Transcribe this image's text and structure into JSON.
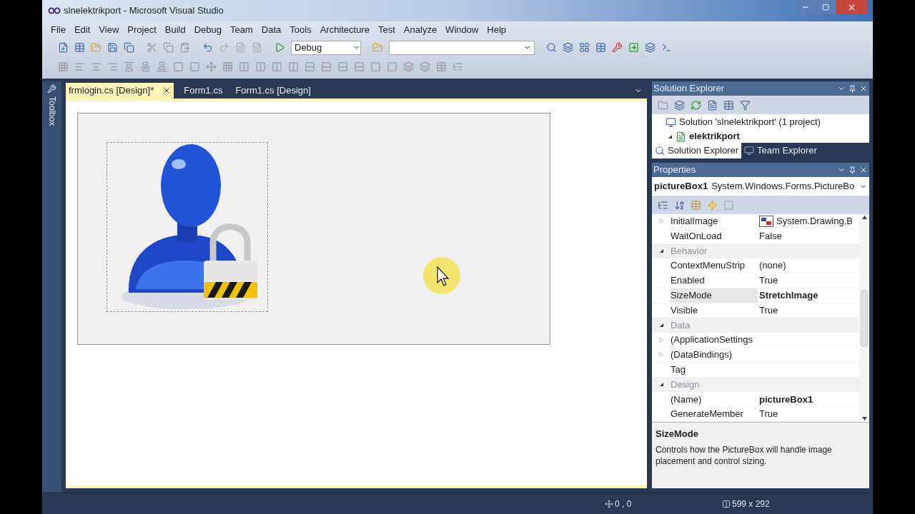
{
  "window": {
    "title": "slnelektrikport - Microsoft Visual Studio"
  },
  "menu": [
    "File",
    "Edit",
    "View",
    "Project",
    "Build",
    "Debug",
    "Team",
    "Data",
    "Tools",
    "Architecture",
    "Test",
    "Analyze",
    "Window",
    "Help"
  ],
  "toolbar": {
    "configuration": "Debug"
  },
  "toolbox": {
    "label": "Toolbox"
  },
  "tabs": [
    {
      "label": "frmlogin.cs [Design]*",
      "selected": true
    },
    {
      "label": "Form1.cs",
      "selected": false
    },
    {
      "label": "Form1.cs [Design]",
      "selected": false
    }
  ],
  "solution_explorer": {
    "title": "Solution Explorer",
    "tree": [
      {
        "label": "Solution 'slnelektrikport' (1 project)",
        "bold": false,
        "children": [
          {
            "label": "elektrikport",
            "bold": true,
            "expanded": true
          }
        ]
      }
    ],
    "tabs": [
      {
        "label": "Solution Explorer",
        "selected": true
      },
      {
        "label": "Team Explorer",
        "selected": false
      }
    ]
  },
  "properties": {
    "title": "Properties",
    "object_name": "pictureBox1",
    "object_type": "System.Windows.Forms.PictureBo",
    "rows": [
      {
        "kind": "property",
        "name": "InitialImage",
        "value": "System.Drawing.B",
        "expandable": true,
        "modified": false,
        "selected": false,
        "image": true
      },
      {
        "kind": "property",
        "name": "WaitOnLoad",
        "value": "False",
        "expandable": false,
        "modified": false,
        "selected": false,
        "image": false
      },
      {
        "kind": "category",
        "name": "Behavior",
        "expanded": true
      },
      {
        "kind": "property",
        "name": "ContextMenuStrip",
        "value": "(none)",
        "expandable": false,
        "modified": false,
        "selected": false,
        "image": false
      },
      {
        "kind": "property",
        "name": "Enabled",
        "value": "True",
        "expandable": false,
        "modified": false,
        "selected": false,
        "image": false
      },
      {
        "kind": "property",
        "name": "SizeMode",
        "value": "StretchImage",
        "expandable": false,
        "modified": true,
        "selected": true,
        "image": false
      },
      {
        "kind": "property",
        "name": "Visible",
        "value": "True",
        "expandable": false,
        "modified": false,
        "selected": false,
        "image": false
      },
      {
        "kind": "category",
        "name": "Data",
        "expanded": true
      },
      {
        "kind": "property",
        "name": "(ApplicationSettings",
        "expandable": true,
        "selected": false,
        "image": false
      },
      {
        "kind": "property",
        "name": "(DataBindings)",
        "expandable": true,
        "selected": false,
        "image": false
      },
      {
        "kind": "property",
        "name": "Tag",
        "expandable": false,
        "selected": false,
        "image": false
      },
      {
        "kind": "category",
        "name": "Design",
        "expanded": true
      },
      {
        "kind": "property",
        "name": "(Name)",
        "value": "pictureBox1",
        "expandable": false,
        "modified": true,
        "selected": false,
        "image": false
      },
      {
        "kind": "property",
        "name": "GenerateMember",
        "value": "True",
        "expandable": false,
        "modified": false,
        "selected": false,
        "image": false
      }
    ],
    "description": {
      "title": "SizeMode",
      "text": "Controls how the PictureBox will handle image placement and control sizing."
    }
  },
  "status_bar": {
    "location": "0 , 0",
    "size": "599 x 292"
  }
}
